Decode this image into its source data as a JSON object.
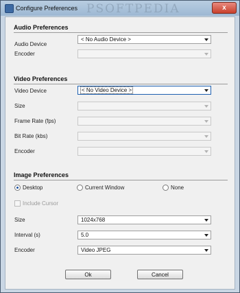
{
  "window": {
    "title": "Configure Preferences",
    "watermark": "PSOFTPEDIA",
    "close_label": "x"
  },
  "audio": {
    "section_title": "Audio Preferences",
    "device_label": "Audio Device",
    "device_value": "< No Audio Device >",
    "encoder_label": "Encoder",
    "encoder_value": ""
  },
  "video": {
    "section_title": "Video Preferences",
    "device_label": "Video Device",
    "device_value": "< No Video Device >",
    "size_label": "Size",
    "size_value": "",
    "frame_rate_label": "Frame Rate (fps)",
    "frame_rate_value": "",
    "bit_rate_label": "Bit Rate (kbs)",
    "bit_rate_value": "",
    "encoder_label": "Encoder",
    "encoder_value": ""
  },
  "image": {
    "section_title": "Image Preferences",
    "radio_desktop": "Desktop",
    "radio_current_window": "Current Window",
    "radio_none": "None",
    "selected": "Desktop",
    "include_cursor_label": "Include Cursor",
    "include_cursor_checked": false,
    "size_label": "Size",
    "size_value": "1024x768",
    "interval_label": "Interval (s)",
    "interval_value": "5.0",
    "encoder_label": "Encoder",
    "encoder_value": "Video JPEG"
  },
  "buttons": {
    "ok": "Ok",
    "cancel": "Cancel"
  }
}
